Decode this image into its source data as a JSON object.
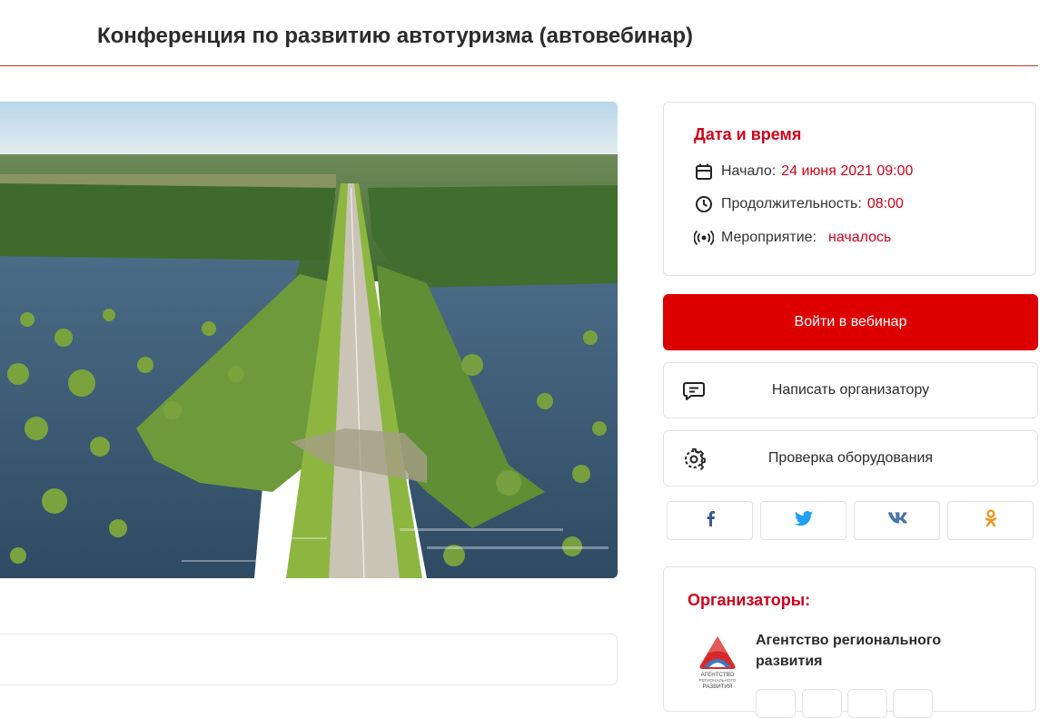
{
  "page": {
    "title": "Конференция по развитию автотуризма (автовебинар)"
  },
  "event_info": {
    "heading": "Дата и время",
    "start_label": "Начало:",
    "start_value": "24 июня 2021 09:00",
    "duration_label": "Продолжительность:",
    "duration_value": "08:00",
    "status_label": "Мероприятие:",
    "status_value": "началось",
    "icons": [
      "calendar-icon",
      "clock-icon",
      "broadcast-icon"
    ]
  },
  "actions": {
    "join_label": "Войти в вебинар",
    "message_label": "Написать организатору",
    "check_label": "Проверка оборудования"
  },
  "share": {
    "networks": [
      "facebook",
      "twitter",
      "vk",
      "odnoklassniki"
    ],
    "colors": {
      "facebook": "#3b5998",
      "twitter": "#1da1f2",
      "vk": "#4a76a8",
      "odnoklassniki": "#f7931e"
    }
  },
  "organizers": {
    "heading": "Организаторы:",
    "name": "Агентство регионального развития",
    "logo_text_line1": "АГЕНТСТВО",
    "logo_text_line2": "РЕГИОНАЛЬНОГО",
    "logo_text_line3": "РАЗВИТИЯ"
  },
  "colors": {
    "accent": "#dd0000",
    "accent_text": "#d0021b"
  }
}
